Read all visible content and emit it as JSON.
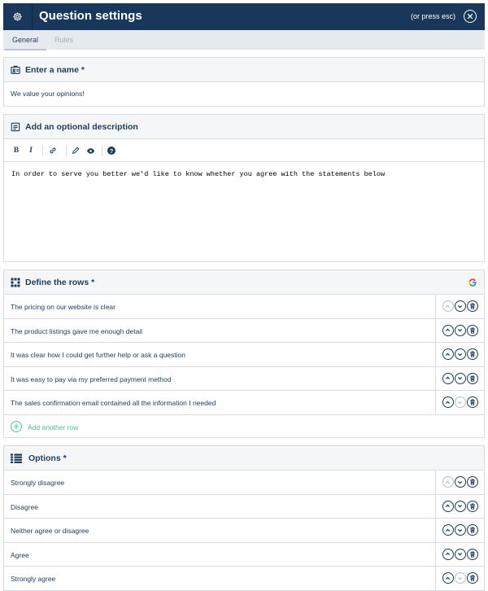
{
  "header": {
    "title": "Question settings",
    "esc_hint": "(or press esc)"
  },
  "tabs": [
    {
      "label": "General",
      "active": true
    },
    {
      "label": "Rules",
      "active": false
    }
  ],
  "name_section": {
    "title": "Enter a name *",
    "value": "We value your opinions!"
  },
  "description_section": {
    "title": "Add an optional description",
    "toolbar": [
      "bold",
      "italic",
      "link",
      "edit",
      "preview",
      "help"
    ],
    "bold_label": "B",
    "italic_label": "I",
    "help_label": "?",
    "text": "In order to serve you better we'd like to know whether you agree with the statements below"
  },
  "rows_section": {
    "title": "Define the rows *",
    "items": [
      {
        "label": "The pricing on our website is clear"
      },
      {
        "label": "The product listings gave me enough detail"
      },
      {
        "label": "It was clear how I could get further help or ask a question"
      },
      {
        "label": "It was easy to pay via my preferred payment method"
      },
      {
        "label": "The sales confirmation email contained all the information I needed"
      }
    ],
    "add_label": "Add another row"
  },
  "options_section": {
    "title": "Options *",
    "items": [
      {
        "label": "Strongly disagree"
      },
      {
        "label": "Disagree"
      },
      {
        "label": "Neither agree or disagree"
      },
      {
        "label": "Agree"
      },
      {
        "label": "Strongly agree"
      }
    ]
  },
  "colors": {
    "header_bg": "#19375a",
    "text": "#1f3b57",
    "add_accent": "#4fb59c",
    "panel_head_bg": "#f4f6f8",
    "border": "#d6dce2"
  }
}
